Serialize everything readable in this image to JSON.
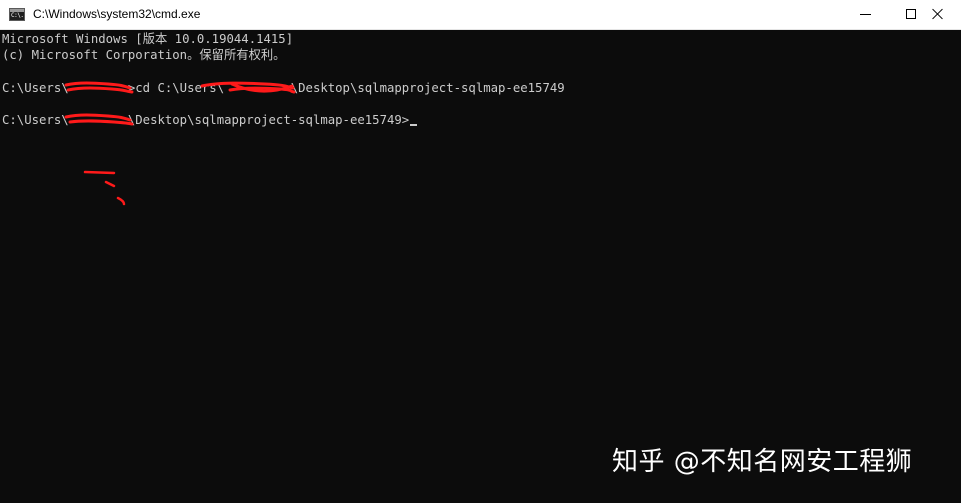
{
  "window": {
    "title": "C:\\Windows\\system32\\cmd.exe",
    "icon": "cmd-icon",
    "icon_text": "C:\\."
  },
  "controls": {
    "minimize": "minimize-icon",
    "maximize": "maximize-icon",
    "close": "close-icon"
  },
  "console": {
    "line1": "Microsoft Windows [版本 10.0.19044.1415]",
    "line2": "(c) Microsoft Corporation。保留所有权利。",
    "line3": "C:\\Users\\        >cd C:\\Users\\         \\Desktop\\sqlmapproject-sqlmap-ee15749",
    "line4": "C:\\Users\\        \\Desktop\\sqlmapproject-sqlmap-ee15749>"
  },
  "watermark": "知乎 @不知名网安工程狮",
  "colors": {
    "background": "#0c0c0c",
    "text": "#cccccc",
    "redaction": "#ff1a1a"
  }
}
